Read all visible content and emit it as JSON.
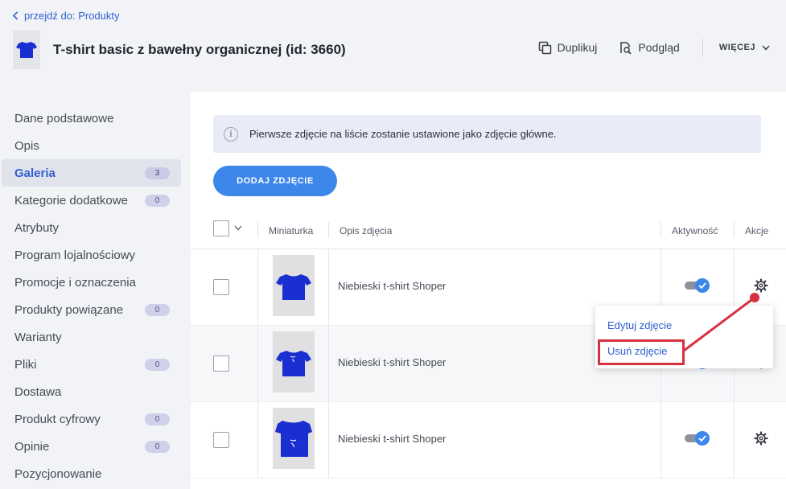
{
  "header": {
    "back_label": "przejdź do: Produkty",
    "title": "T-shirt basic z bawełny organicznej (id: 3660)",
    "duplicate_label": "Duplikuj",
    "preview_label": "Podgląd",
    "more_label": "WIĘCEJ"
  },
  "sidebar": {
    "items": [
      {
        "label": "Dane podstawowe"
      },
      {
        "label": "Opis"
      },
      {
        "label": "Galeria",
        "badge": "3"
      },
      {
        "label": "Kategorie dodatkowe",
        "badge": "0"
      },
      {
        "label": "Atrybuty"
      },
      {
        "label": "Program lojalnościowy"
      },
      {
        "label": "Promocje i oznaczenia"
      },
      {
        "label": "Produkty powiązane",
        "badge": "0"
      },
      {
        "label": "Warianty"
      },
      {
        "label": "Pliki",
        "badge": "0"
      },
      {
        "label": "Dostawa"
      },
      {
        "label": "Produkt cyfrowy",
        "badge": "0"
      },
      {
        "label": "Opinie",
        "badge": "0"
      },
      {
        "label": "Pozycjonowanie"
      }
    ]
  },
  "gallery": {
    "info_icon": "i",
    "info_text": "Pierwsze zdjęcie na liście zostanie ustawione jako zdjęcie główne.",
    "add_button": "DODAJ ZDJĘCIE",
    "columns": {
      "thumbnail": "Miniaturka",
      "description": "Opis zdjęcia",
      "activity": "Aktywność",
      "actions": "Akcje"
    },
    "rows": [
      {
        "description": "Niebieski t-shirt Shoper",
        "active": true
      },
      {
        "description": "Niebieski t-shirt Shoper",
        "active": true
      },
      {
        "description": "Niebieski t-shirt Shoper",
        "active": true
      }
    ]
  },
  "dropdown": {
    "edit_label": "Edytuj zdjęcie",
    "delete_label": "Usuń zdjęcie"
  },
  "colors": {
    "accent": "#3d86ea",
    "link": "#2f5fd0",
    "highlight": "#d7313e",
    "shirt": "#1a2fd1"
  },
  "icons": [
    "chevron-left-icon",
    "duplicate-icon",
    "preview-icon",
    "chevron-down-icon",
    "info-icon",
    "check-icon",
    "gear-icon"
  ]
}
